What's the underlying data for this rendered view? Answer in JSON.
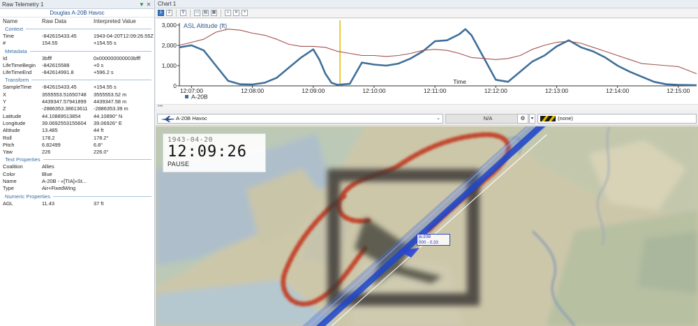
{
  "telemetry": {
    "title": "Raw Telemetry 1",
    "object_name": "Douglas A-20B Havoc",
    "columns": [
      "Name",
      "Raw Data",
      "Interpreted Value"
    ],
    "sections": [
      {
        "label": "Context",
        "rows": [
          {
            "name": "Time",
            "raw": "-842615433.45",
            "value": "1943-04-20T12:09:26.55Z"
          },
          {
            "name": "#",
            "raw": "154.55",
            "value": "+154.55 s"
          }
        ]
      },
      {
        "label": "Metadata",
        "rows": [
          {
            "name": "Id",
            "raw": "3bfff",
            "value": "0x000000000003bfff"
          },
          {
            "name": "LifeTimeBegin",
            "raw": "-842615588",
            "value": "+0 s"
          },
          {
            "name": "LifeTimeEnd",
            "raw": "-842614991.8",
            "value": "+596.2 s"
          }
        ]
      },
      {
        "label": "Transform",
        "rows": [
          {
            "name": "SampleTime",
            "raw": "-842615433.45",
            "value": "+154.55 s"
          },
          {
            "name": "X",
            "raw": "3555553.51650748",
            "value": "3555553.52 m"
          },
          {
            "name": "Y",
            "raw": "4439347.57941899",
            "value": "4439347.58 m"
          },
          {
            "name": "Z",
            "raw": "-2886353.38613611",
            "value": "-2886353.39 m"
          },
          {
            "name": "Latitude",
            "raw": "44.10889513854",
            "value": "44.10890° N"
          },
          {
            "name": "Longitude",
            "raw": "39.0692553155604",
            "value": "39.06926° E"
          },
          {
            "name": "Altitude",
            "raw": "13.485",
            "value": "44 ft"
          },
          {
            "name": "Roll",
            "raw": "178.2",
            "value": "178.2°"
          },
          {
            "name": "Pitch",
            "raw": "6.82499",
            "value": "6.8°"
          },
          {
            "name": "Yaw",
            "raw": "226",
            "value": "226.0°"
          }
        ]
      },
      {
        "label": "Text Properties",
        "rows": [
          {
            "name": "Coalition",
            "raw": "Allies",
            "value": ""
          },
          {
            "name": "Color",
            "raw": "Blue",
            "value": ""
          },
          {
            "name": "Name",
            "raw": "A-20B - «[TIA]»St...",
            "value": ""
          },
          {
            "name": "Type",
            "raw": "Air+FixedWing",
            "value": ""
          }
        ]
      },
      {
        "label": "Numeric Properties",
        "rows": [
          {
            "name": "AGL",
            "raw": "11.43",
            "value": "37 ft"
          }
        ]
      }
    ]
  },
  "chart_panel": {
    "title": "Chart 1",
    "toolbar_pages": [
      "1",
      "2"
    ],
    "scroll_marker": "•••"
  },
  "chart_data": {
    "type": "line",
    "title": "ASL Altitude (ft)",
    "xlabel": "Time",
    "ylabel": "",
    "x_ticks": [
      "12:07:00",
      "12:08:00",
      "12:09:00",
      "12:10:00",
      "12:11:00",
      "12:12:00",
      "12:13:00",
      "12:14:00",
      "12:15:00"
    ],
    "y_ticks": [
      "0",
      "1,000",
      "2,000",
      "3,000"
    ],
    "ylim": [
      0,
      3100
    ],
    "xlim_minutes": [
      -0.2,
      8.3
    ],
    "cursor_minutes": 2.44,
    "legend": "A-20B",
    "legend_position": "bottom-left",
    "grid": false,
    "series": [
      {
        "name": "A-20B",
        "color": "#3e6f9a",
        "x": [
          -0.2,
          0.0,
          0.2,
          0.4,
          0.6,
          0.8,
          1.0,
          1.2,
          1.4,
          1.6,
          1.8,
          2.0,
          2.1,
          2.2,
          2.3,
          2.4,
          2.6,
          2.8,
          3.0,
          3.2,
          3.4,
          3.6,
          3.8,
          4.0,
          4.2,
          4.4,
          4.5,
          4.6,
          4.8,
          5.0,
          5.2,
          5.4,
          5.6,
          5.8,
          6.0,
          6.2,
          6.4,
          6.6,
          6.8,
          7.0,
          7.2,
          7.4,
          7.6,
          7.8,
          8.0,
          8.3
        ],
        "y": [
          1900,
          2000,
          1750,
          1000,
          250,
          80,
          70,
          150,
          400,
          900,
          1400,
          1800,
          1300,
          600,
          150,
          50,
          100,
          1150,
          1050,
          1000,
          1100,
          1350,
          1700,
          2200,
          2250,
          2550,
          2800,
          2500,
          1400,
          300,
          200,
          700,
          1200,
          1500,
          1950,
          2250,
          1900,
          1700,
          1400,
          1000,
          700,
          450,
          200,
          80,
          50,
          30
        ]
      },
      {
        "name": "",
        "color": "#a0524d",
        "x": [
          -0.2,
          0.0,
          0.2,
          0.4,
          0.6,
          0.8,
          1.0,
          1.2,
          1.4,
          1.6,
          1.8,
          2.0,
          2.2,
          2.4,
          2.6,
          2.8,
          3.0,
          3.2,
          3.4,
          3.6,
          3.8,
          4.0,
          4.2,
          4.4,
          4.6,
          4.8,
          5.0,
          5.2,
          5.4,
          5.6,
          5.8,
          6.0,
          6.2,
          6.4,
          6.6,
          6.8,
          7.0,
          7.2,
          7.4,
          7.6,
          7.8,
          8.0,
          8.3
        ],
        "y": [
          2000,
          2150,
          2300,
          2650,
          2800,
          2750,
          2600,
          2500,
          2300,
          2050,
          1950,
          1950,
          1900,
          1700,
          1600,
          1500,
          1500,
          1450,
          1500,
          1600,
          1750,
          1800,
          1750,
          1600,
          1400,
          1350,
          1300,
          1350,
          1500,
          1800,
          2000,
          2150,
          2200,
          2100,
          1900,
          1700,
          1500,
          1300,
          1100,
          1050,
          1000,
          950,
          600
        ]
      }
    ]
  },
  "selectors": {
    "object": "A-20B Havoc",
    "secondary": "N/A",
    "color_label": "(none)"
  },
  "map": {
    "date": "1943-04-20",
    "time": "12:09:26",
    "status": "PAUSE",
    "label_line1": "A-20B",
    "label_line2": "000 - 0.33"
  }
}
